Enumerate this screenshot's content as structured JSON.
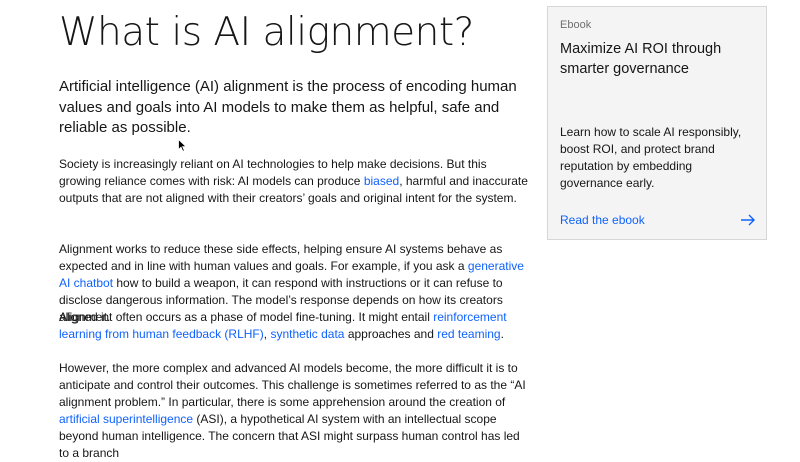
{
  "article": {
    "title": "What is AI alignment?",
    "lead": "Artificial intelligence (AI) alignment is the process of encoding human values and goals into AI models to make them as helpful, safe and reliable as possible.",
    "p1": {
      "t1": "Society is increasingly reliant on AI technologies to help make decisions. But this growing reliance comes with risk: AI models can produce ",
      "link1": "biased",
      "t2": ", harmful and inaccurate outputs that are not aligned with their creators’ goals and original intent for the system."
    },
    "p2": {
      "t1": "Alignment works to reduce these side effects, helping ensure AI systems behave as expected and in line with human values and goals. For example, if you ask a ",
      "link1": "generative AI chatbot",
      "t2": " how to build a weapon, it can respond with instructions or it can refuse to disclose dangerous information. The model’s response depends on how its creators aligned it."
    },
    "p3": {
      "t1": "Alignment often occurs as a phase of model fine-tuning. It might entail ",
      "link1": "reinforcement learning from human feedback (RLHF)",
      "t2": ", ",
      "link2": "synthetic data",
      "t3": " approaches and ",
      "link3": "red teaming",
      "t4": "."
    },
    "p4": {
      "t1": "However, the more complex and advanced AI models become, the more difficult it is to anticipate and control their outcomes. This challenge is sometimes referred to as the “AI alignment problem.” In particular, there is some apprehension around the creation of ",
      "link1": "artificial superintelligence",
      "t2": " (ASI), a hypothetical AI system with an intellectual scope beyond human intelligence. The concern that ASI might surpass human control has led to a branch"
    }
  },
  "card": {
    "eyebrow": "Ebook",
    "title": "Maximize AI ROI through smarter governance",
    "description": "Learn how to scale AI responsibly, boost ROI, and protect brand reputation by embedding governance early.",
    "cta": "Read the ebook",
    "cta_icon": "arrow-right-icon"
  },
  "colors": {
    "link": "#0f62fe",
    "text": "#161616",
    "card_bg": "#f4f4f4",
    "eyebrow": "#6f6f6f"
  }
}
